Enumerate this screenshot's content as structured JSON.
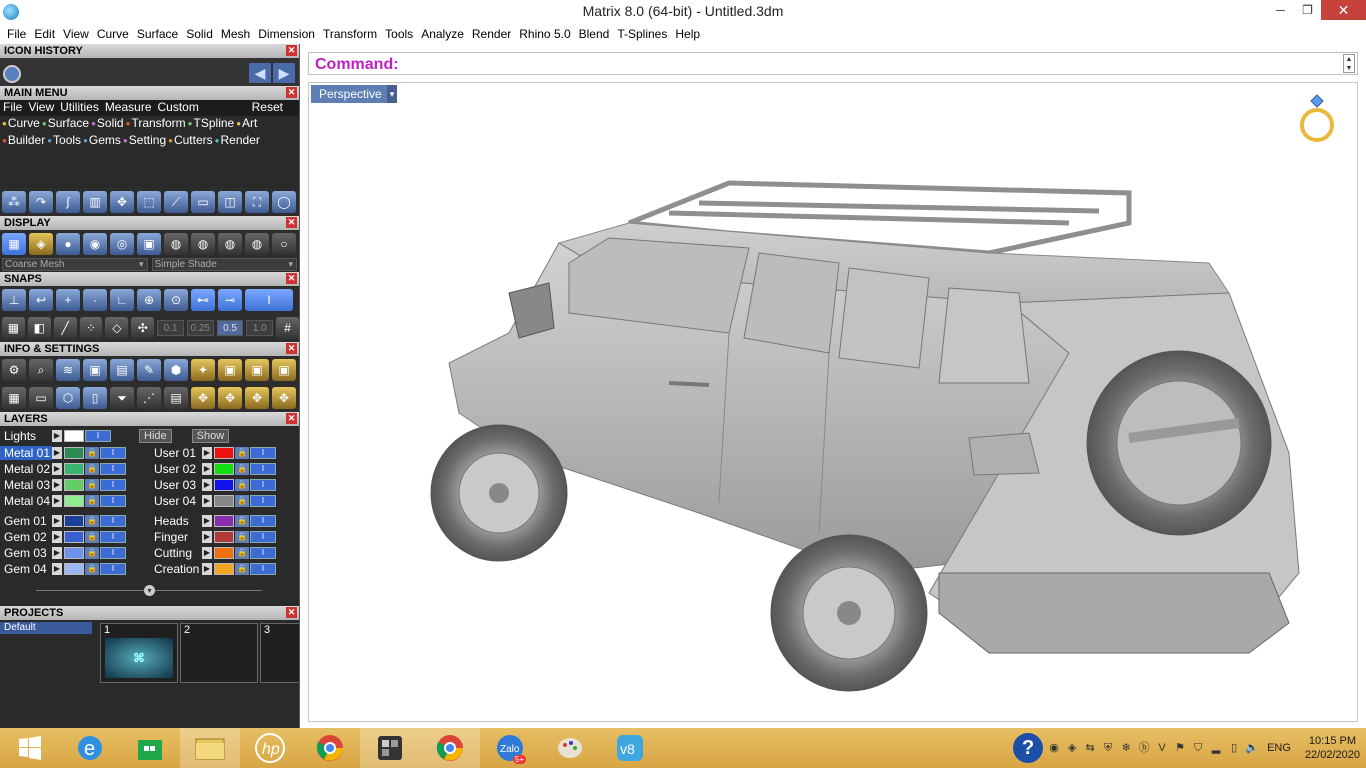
{
  "window": {
    "title": "Matrix 8.0 (64-bit) - Untitled.3dm",
    "minimize": "─",
    "restore": "❐",
    "close": "✕"
  },
  "menubar": [
    "File",
    "Edit",
    "View",
    "Curve",
    "Surface",
    "Solid",
    "Mesh",
    "Dimension",
    "Transform",
    "Tools",
    "Analyze",
    "Render",
    "Rhino 5.0",
    "Blend",
    "T-Splines",
    "Help"
  ],
  "icon_history": {
    "title": "ICON HISTORY"
  },
  "main_menu": {
    "title": "MAIN MENU",
    "menu": [
      "File",
      "View",
      "Utilities",
      "Measure",
      "Custom"
    ],
    "reset": "Reset",
    "row1": [
      "Curve",
      "Surface",
      "Solid",
      "Transform",
      "TSpline",
      "Art"
    ],
    "row2": [
      "Builder",
      "Tools",
      "Gems",
      "Setting",
      "Cutters",
      "Render"
    ]
  },
  "display": {
    "title": "DISPLAY",
    "mesh_dropdown": "Coarse Mesh",
    "shade_dropdown": "Simple Shade"
  },
  "snaps": {
    "title": "SNAPS",
    "values": [
      "0.1",
      "0.25",
      "0.5",
      "1.0"
    ]
  },
  "info_settings": {
    "title": "INFO & SETTINGS"
  },
  "layers": {
    "title": "LAYERS",
    "lights": "Lights",
    "hide": "Hide",
    "show": "Show",
    "left": [
      {
        "name": "Metal 01",
        "color": "#2e8b57",
        "selected": true
      },
      {
        "name": "Metal 02",
        "color": "#3cb371",
        "selected": false
      },
      {
        "name": "Metal 03",
        "color": "#66cc66",
        "selected": false
      },
      {
        "name": "Metal 04",
        "color": "#90ee90",
        "selected": false
      },
      {
        "name": "Gem 01",
        "color": "#1c3f9a",
        "selected": false
      },
      {
        "name": "Gem 02",
        "color": "#3a5fd0",
        "selected": false
      },
      {
        "name": "Gem 03",
        "color": "#6f93ea",
        "selected": false
      },
      {
        "name": "Gem 04",
        "color": "#9cb8f2",
        "selected": false
      }
    ],
    "right": [
      {
        "name": "User 01",
        "color": "#ee1111"
      },
      {
        "name": "User 02",
        "color": "#11dd11"
      },
      {
        "name": "User 03",
        "color": "#1111ee"
      },
      {
        "name": "User 04",
        "color": "#888888"
      },
      {
        "name": "Heads",
        "color": "#8a2fb0"
      },
      {
        "name": "Finger",
        "color": "#b03a3a"
      },
      {
        "name": "Cutting",
        "color": "#ee7011"
      },
      {
        "name": "Creation",
        "color": "#f5a623"
      }
    ]
  },
  "projects": {
    "title": "PROJECTS",
    "default": "Default",
    "tiles": [
      "1",
      "2",
      "3"
    ]
  },
  "command": {
    "label": "Command:"
  },
  "viewport": {
    "name": "Perspective"
  },
  "taskbar": {
    "lang": "ENG",
    "time": "10:15 PM",
    "date": "22/02/2020",
    "zalo_badge": "5+"
  }
}
